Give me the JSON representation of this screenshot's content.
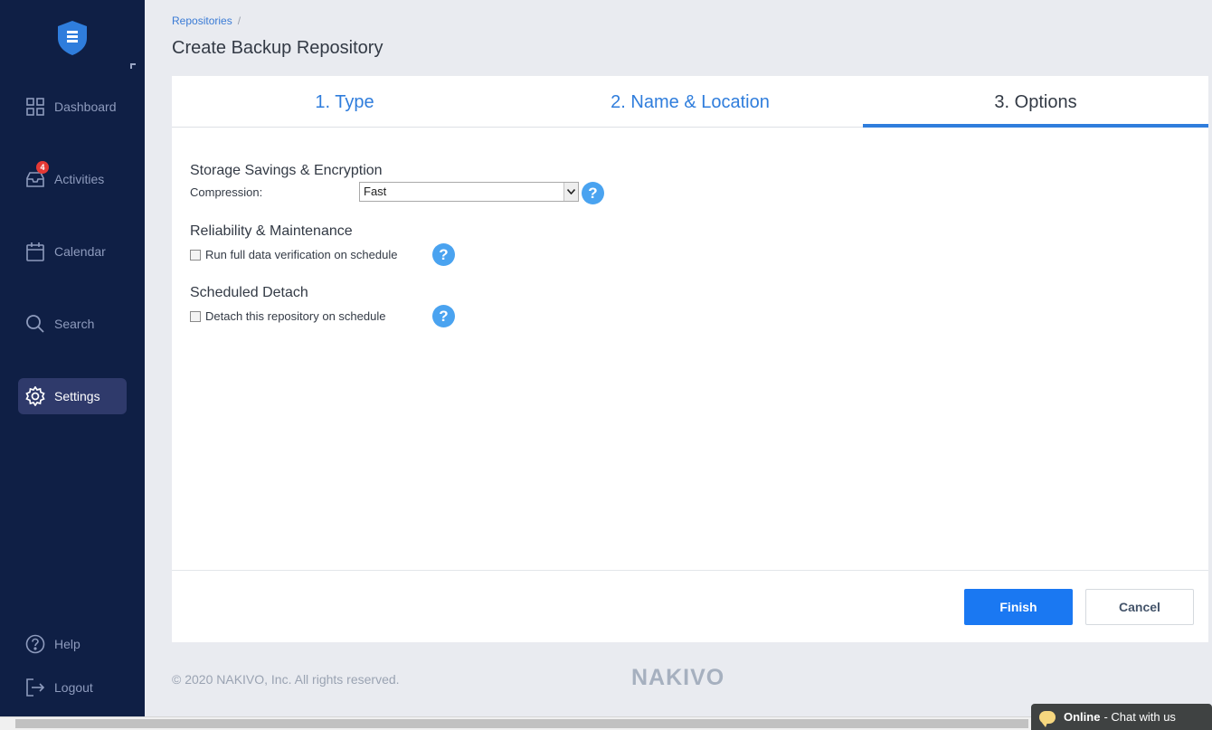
{
  "sidebar": {
    "badge_count": "4",
    "items": [
      {
        "label": "Dashboard",
        "icon": "grid-icon"
      },
      {
        "label": "Activities",
        "icon": "inbox-icon"
      },
      {
        "label": "Calendar",
        "icon": "calendar-icon"
      },
      {
        "label": "Search",
        "icon": "search-icon"
      },
      {
        "label": "Settings",
        "icon": "gear-icon",
        "active": true
      },
      {
        "label": "Help",
        "icon": "question-circle-icon"
      },
      {
        "label": "Logout",
        "icon": "logout-icon"
      }
    ]
  },
  "header": {
    "breadcrumb": "Repositories",
    "breadcrumb_sep": "/",
    "title": "Create Backup Repository"
  },
  "wizard": {
    "tabs": [
      {
        "label": "1. Type"
      },
      {
        "label": "2. Name & Location"
      },
      {
        "label": "3. Options",
        "current": true
      }
    ]
  },
  "options": {
    "storage_title": "Storage Savings & Encryption",
    "compression_label": "Compression:",
    "compression_value": "Fast",
    "reliability_title": "Reliability & Maintenance",
    "verification_label": "Run full data verification on schedule",
    "verification_checked": false,
    "detach_title": "Scheduled Detach",
    "detach_label": "Detach this repository on schedule",
    "detach_checked": false,
    "help_glyph": "?"
  },
  "buttons": {
    "finish": "Finish",
    "cancel": "Cancel"
  },
  "footer": {
    "copyright": "© 2020 NAKIVO, Inc. All rights reserved.",
    "brand": "NAKIVO"
  },
  "chat": {
    "status": "Online",
    "text": "- Chat with us"
  },
  "colors": {
    "sidebar_bg": "#0f1f45",
    "accent": "#1a78f2",
    "help_icon": "#4aa3f0",
    "badge": "#e53935"
  }
}
